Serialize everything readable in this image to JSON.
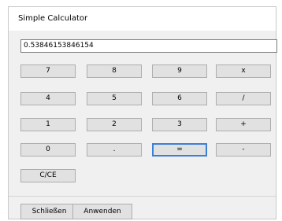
{
  "window": {
    "title": "Simple Calculator"
  },
  "display": {
    "value": "0.53846153846154"
  },
  "keypad": {
    "row1": [
      "7",
      "8",
      "9",
      "x"
    ],
    "row2": [
      "4",
      "5",
      "6",
      "/"
    ],
    "row3": [
      "1",
      "2",
      "3",
      "+"
    ],
    "row4": [
      "0",
      ".",
      "=",
      "-"
    ],
    "row5": [
      "C/CE"
    ]
  },
  "footer": {
    "close_label": "Schließen",
    "apply_label": "Anwenden"
  },
  "colors": {
    "focus_border": "#3c7fd6",
    "button_bg": "#e1e1e1",
    "window_bg": "#f0f0f0"
  }
}
